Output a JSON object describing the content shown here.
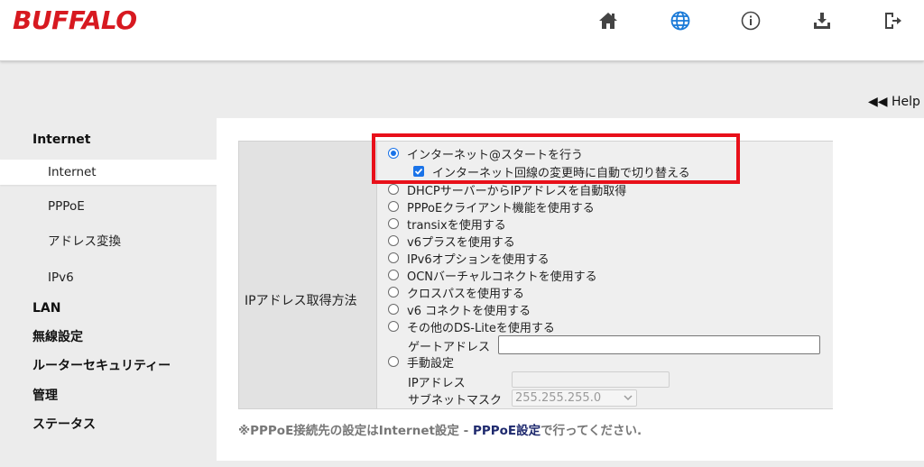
{
  "brand": {
    "logo_text": "BUFFALO",
    "color": "#d71920"
  },
  "nav_icons": [
    "home-icon",
    "globe-icon",
    "info-icon",
    "download-icon",
    "logout-icon"
  ],
  "help": {
    "label": "◀◀ Help"
  },
  "sidebar": {
    "internet_header": "Internet",
    "internet_items": [
      "Internet",
      "PPPoE",
      "アドレス変換",
      "IPv6"
    ],
    "lan": "LAN",
    "wireless": "無線設定",
    "security": "ルーターセキュリティー",
    "admin": "管理",
    "status": "ステータス"
  },
  "form": {
    "field_label": "IPアドレス取得方法",
    "options": [
      {
        "label": "インターネット@スタートを行う",
        "selected": true
      },
      {
        "label": "DHCPサーバーからIPアドレスを自動取得",
        "selected": false
      },
      {
        "label": "PPPoEクライアント機能を使用する",
        "selected": false
      },
      {
        "label": "transixを使用する",
        "selected": false
      },
      {
        "label": "v6プラスを使用する",
        "selected": false
      },
      {
        "label": "IPv6オプションを使用する",
        "selected": false
      },
      {
        "label": "OCNバーチャルコネクトを使用する",
        "selected": false
      },
      {
        "label": "クロスパスを使用する",
        "selected": false
      },
      {
        "label": "v6 コネクトを使用する",
        "selected": false
      },
      {
        "label": "その他のDS-Liteを使用する",
        "selected": false
      },
      {
        "label": "手動設定",
        "selected": false
      }
    ],
    "auto_switch_checkbox": {
      "label": "インターネット回線の変更時に自動で切り替える",
      "checked": true
    },
    "gateway_label": "ゲートアドレス",
    "gateway_value": "",
    "ip_label": "IPアドレス",
    "ip_value": "",
    "mask_label": "サブネットマスク",
    "mask_value": "255.255.255.0"
  },
  "footnote": {
    "prefix": "※PPPoE接続先の設定はInternet設定 - ",
    "link": "PPPoE設定",
    "suffix": "で行ってください."
  },
  "colors": {
    "accent": "#1a73e8",
    "highlight": "#e8101a",
    "link": "#1f2a6e"
  }
}
